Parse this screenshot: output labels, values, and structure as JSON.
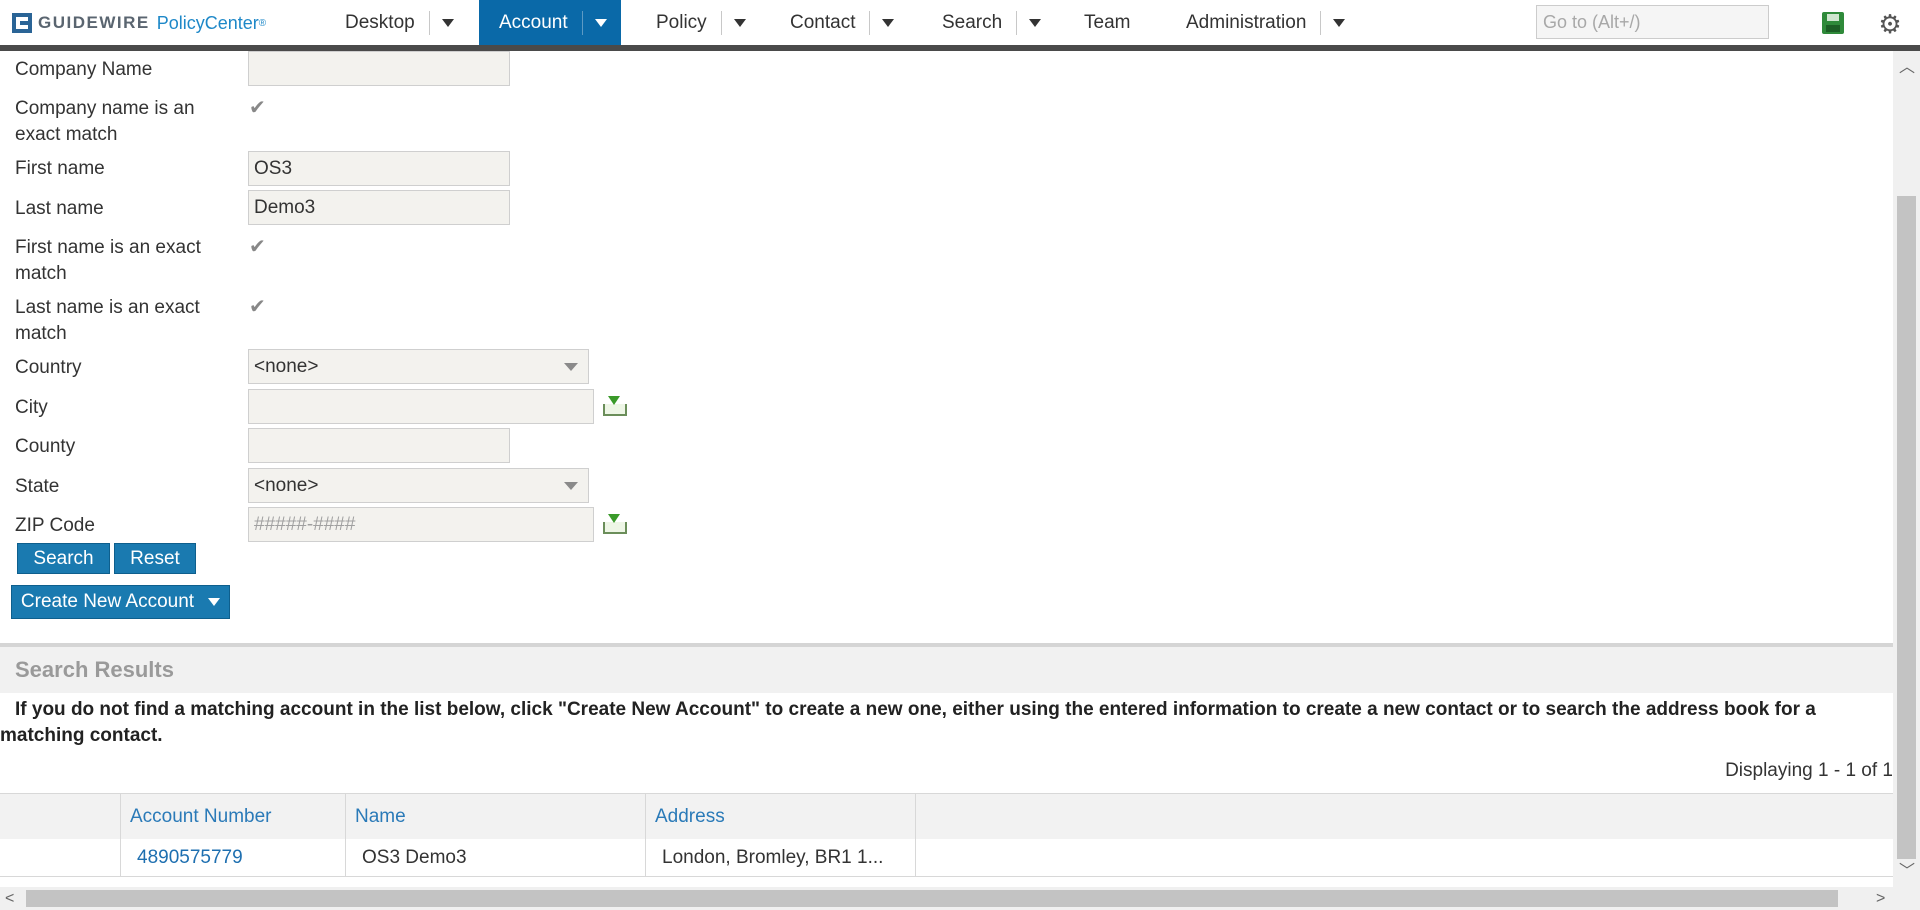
{
  "app": {
    "brand": "GUIDEWIRE",
    "product": "PolicyCenter",
    "reg": "®"
  },
  "nav": {
    "desktop": "Desktop",
    "account": "Account",
    "policy": "Policy",
    "contact": "Contact",
    "search": "Search",
    "team": "Team",
    "administration": "Administration",
    "goto_placeholder": "Go to (Alt+/)"
  },
  "form": {
    "company_name": {
      "label": "Company Name",
      "value": ""
    },
    "company_exact": {
      "label": "Company name is an exact match",
      "checked": true
    },
    "first_name": {
      "label": "First name",
      "value": "OS3"
    },
    "last_name": {
      "label": "Last name",
      "value": "Demo3"
    },
    "first_exact": {
      "label": "First name is an exact match",
      "checked": true
    },
    "last_exact": {
      "label": "Last name is an exact match",
      "checked": true
    },
    "country": {
      "label": "Country",
      "value": "<none>"
    },
    "city": {
      "label": "City",
      "value": ""
    },
    "county": {
      "label": "County",
      "value": ""
    },
    "state": {
      "label": "State",
      "value": "<none>"
    },
    "zip": {
      "label": "ZIP Code",
      "placeholder": "#####-####"
    },
    "search_button": "Search",
    "reset_button": "Reset",
    "create_button": "Create New Account"
  },
  "results": {
    "title": "Search Results",
    "message": "If you do not find a matching account in the list below, click \"Create New Account\" to create a new one, either using the entered information to create a new contact or to search the address book for a matching contact.",
    "displaying": "Displaying 1 - 1 of 1",
    "columns": [
      "Account Number",
      "Name",
      "Address"
    ],
    "rows": [
      {
        "account_number": "4890575779",
        "name": "OS3 Demo3",
        "address": "London, Bromley, BR1 1..."
      }
    ]
  },
  "colors": {
    "accent": "#0a69a8",
    "button": "#1a7ab0",
    "link": "#1e6fb0"
  }
}
